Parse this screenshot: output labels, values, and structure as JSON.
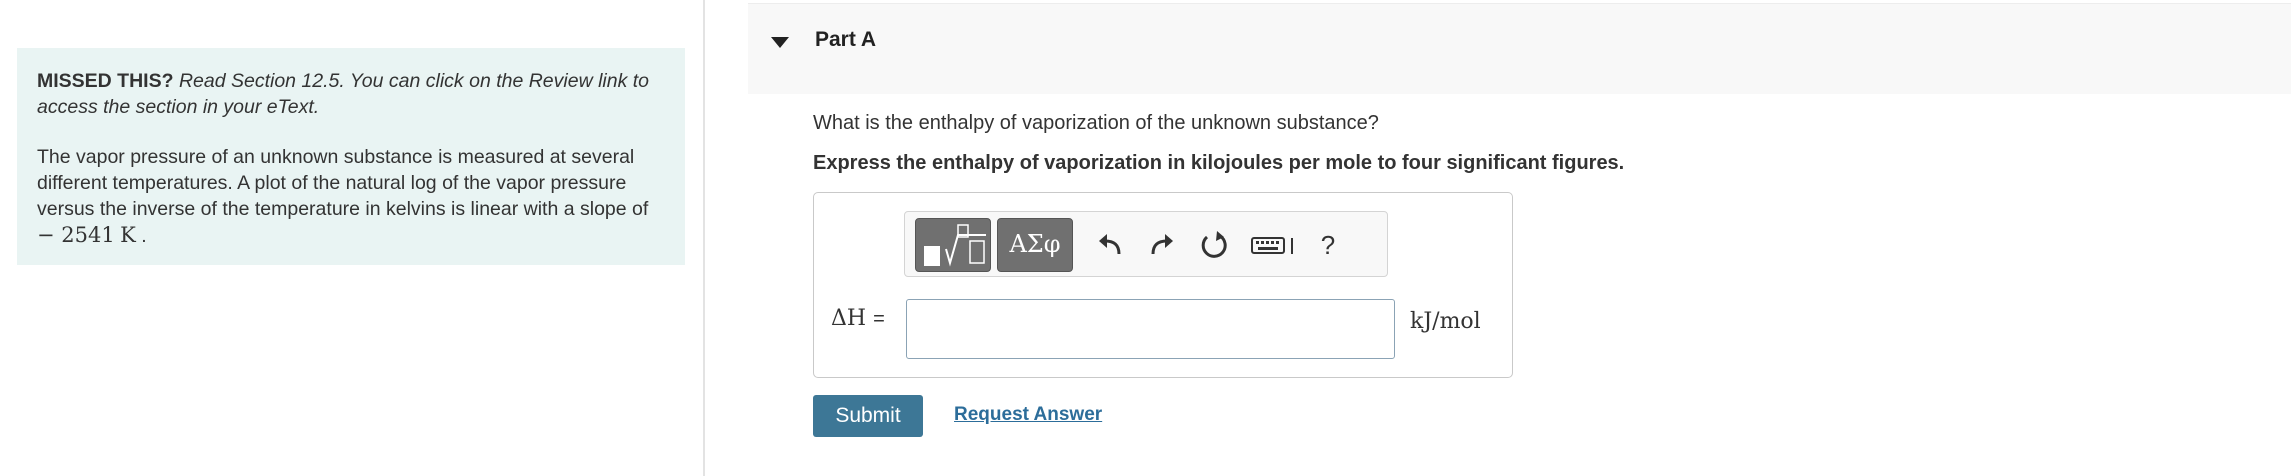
{
  "hint": {
    "missed_label": "MISSED THIS?",
    "missed_text": "Read Section 12.5. You can click on the Review link to access the section in your eText.",
    "problem_text": "The vapor pressure of an unknown substance is measured at several different temperatures. A plot of the natural log of the vapor pressure versus the inverse of the temperature in kelvins is linear with a slope of",
    "slope_value": "− 2541",
    "slope_unit": "K",
    "period": "."
  },
  "part": {
    "title": "Part A",
    "question": "What is the enthalpy of vaporization of the unknown substance?",
    "instruction": "Express the enthalpy of vaporization in kilojoules per mole to four significant figures."
  },
  "toolbar": {
    "greek_label": "ΑΣφ",
    "help_label": "?",
    "icons": [
      "templates-icon",
      "greek-symbols-icon",
      "undo-icon",
      "redo-icon",
      "reset-icon",
      "keyboard-icon",
      "help-icon"
    ]
  },
  "answer": {
    "label_var": "ΔH",
    "label_eq": "=",
    "value": "",
    "unit": "kJ/mol"
  },
  "actions": {
    "submit_label": "Submit",
    "request_label": "Request Answer"
  },
  "colors": {
    "hint_bg": "#e9f4f3",
    "submit_bg": "#3d7796",
    "link": "#2c6d9a",
    "toolbar_button": "#707070"
  }
}
